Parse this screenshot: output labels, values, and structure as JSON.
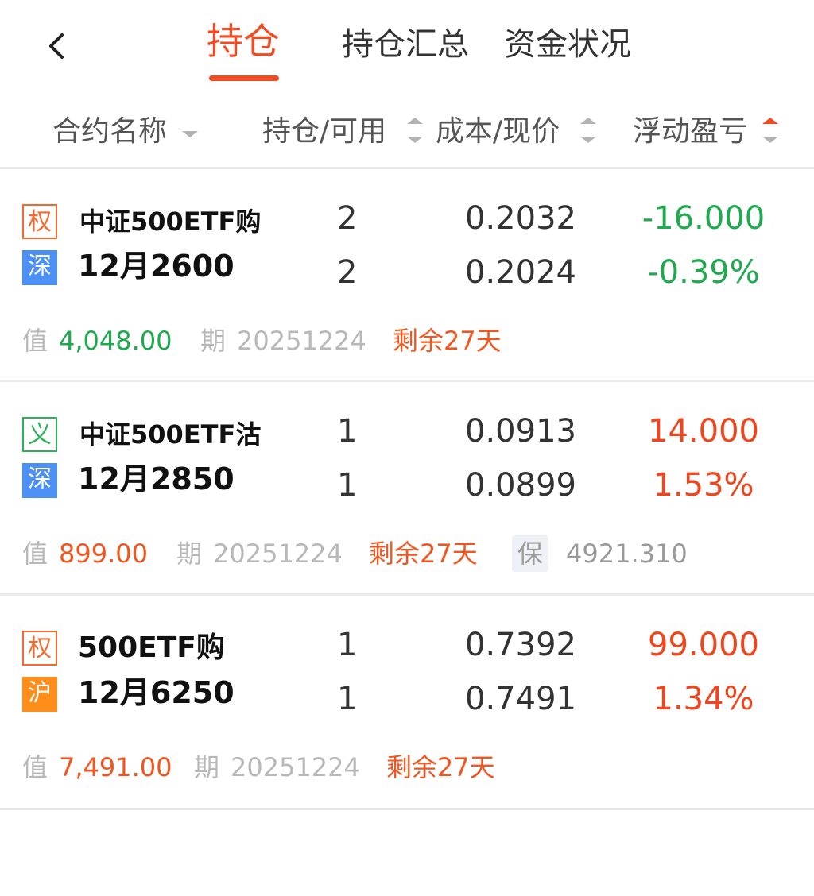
{
  "header": {
    "back_icon": "chevron-left-icon",
    "tabs": [
      {
        "label": "持仓",
        "active": true
      },
      {
        "label": "持仓汇总",
        "active": false
      },
      {
        "label": "资金状况",
        "active": false
      }
    ]
  },
  "columns": {
    "name": "合约名称",
    "position": "持仓/可用",
    "cost": "成本/现价",
    "pnl": "浮动盈亏",
    "sort_active": "pnl-ascending"
  },
  "colors": {
    "accent": "#f04b22",
    "profit": "#f0461e",
    "loss": "#1faa4f",
    "shen_badge": "#4c8ff5",
    "hu_badge": "#ff8d1a"
  },
  "positions": [
    {
      "type_badge": "权",
      "exchange_badge": "深",
      "name": "中证500ETF购",
      "contract": "12月2600",
      "position": "2",
      "available": "2",
      "cost": "0.2032",
      "current": "0.2024",
      "pnl": "-16.000",
      "pnl_pct": "-0.39%",
      "value_label": "值",
      "value": "4,048.00",
      "expiry_label": "期",
      "expiry": "20251224",
      "remaining": "剩余27天"
    },
    {
      "type_badge": "义",
      "exchange_badge": "深",
      "name": "中证500ETF沽",
      "contract": "12月2850",
      "position": "1",
      "available": "1",
      "cost": "0.0913",
      "current": "0.0899",
      "pnl": "14.000",
      "pnl_pct": "1.53%",
      "value_label": "值",
      "value": "899.00",
      "expiry_label": "期",
      "expiry": "20251224",
      "remaining": "剩余27天",
      "margin_label": "保",
      "margin": "4921.310"
    },
    {
      "type_badge": "权",
      "exchange_badge": "沪",
      "name": "500ETF购",
      "contract": "12月6250",
      "position": "1",
      "available": "1",
      "cost": "0.7392",
      "current": "0.7491",
      "pnl": "99.000",
      "pnl_pct": "1.34%",
      "value_label": "值",
      "value": "7,491.00",
      "expiry_label": "期",
      "expiry": "20251224",
      "remaining": "剩余27天"
    }
  ]
}
